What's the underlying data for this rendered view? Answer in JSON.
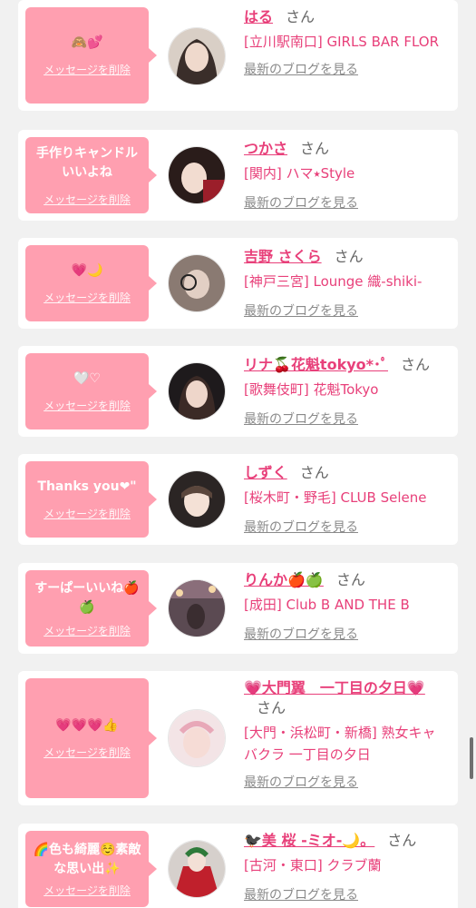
{
  "common": {
    "delete_label": "メッセージを削除",
    "blog_label": "最新のブログを見る",
    "san": "さん"
  },
  "messages": [
    {
      "bubble_text": "🙈💕",
      "name": "はる",
      "shop": "[立川駅南口] GIRLS BAR FLOR"
    },
    {
      "bubble_text": "手作りキャンドルいいよね",
      "name": "つかさ",
      "shop": "[関内] ハマ⭑Style"
    },
    {
      "bubble_text": "💗🌙",
      "name": "吉野 さくら",
      "shop": "[神戸三宮] Lounge 織-shiki-"
    },
    {
      "bubble_text": "🤍♡",
      "name": "リナ🍒花魁tokyo*･ﾟ",
      "shop": "[歌舞伎町] 花魁Tokyo"
    },
    {
      "bubble_text": "Thanks you❤\"",
      "name": "しずく",
      "shop": "[桜木町・野毛] CLUB Selene"
    },
    {
      "bubble_text": "すーぱーいいね🍎🍏",
      "name": "りんか🍎🍏",
      "shop": "[成田] Club B AND THE B"
    },
    {
      "bubble_text": "💗💗💗👍",
      "name": "💗大門翼　一丁目の夕日💗",
      "shop": "[大門・浜松町・新橋] 熟女キャバクラ 一丁目の夕日"
    },
    {
      "bubble_text": "🌈色も綺麗☺️素敵な思い出✨",
      "name": "🐦‍⬛美 桜 -ミオ-🌙。",
      "shop": "[古河・東口] クラブ蘭"
    }
  ],
  "colors": {
    "accent": "#e8407a",
    "bubble": "#ff9fb0",
    "background": "#f1f1f1"
  }
}
